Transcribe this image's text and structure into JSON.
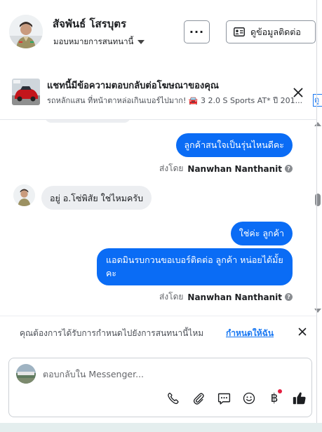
{
  "header": {
    "name": "สัจพันธ์ โสรบุตร",
    "assign_label": "มอบหมายการสนทนานี้",
    "more_label": "···",
    "contact_label": "ดูข้อมูลติดต่อ"
  },
  "ad_banner": {
    "title": "แชทนี้มีข้อความตอบกลับต่อโฆษณาของคุณ",
    "subtitle": "รถหลักแสน ที่หน้าตาหล่อเกินเบอร์ไปมาก! 🚘 3 2.0 S Sports AT* ปี 201...",
    "edge_text": "ดู"
  },
  "messages": [
    {
      "direction": "out",
      "text": "ลูกค้าสนใจเป็นรุ่นไหนดีคะ"
    },
    {
      "direction": "sent_by",
      "label": "ส่งโดย",
      "sender": "Nanwhan Nanthanit"
    },
    {
      "direction": "in",
      "text": "อยู่ อ.โซ่พิสัย ใช่ไหมครับ"
    },
    {
      "direction": "out",
      "text": "ใช่ค่ะ  ลูกค้า"
    },
    {
      "direction": "out",
      "text": "แอดมินรบกวนขอเบอร์ติดต่อ ลูกค้า  หน่อยได้มั้ยคะ"
    },
    {
      "direction": "sent_by",
      "label": "ส่งโดย",
      "sender": "Nanwhan Nanthanit"
    }
  ],
  "info_glyph": "?",
  "notice": {
    "text": "คุณต้องการได้รับการกำหนดไปยังการสนทนานี้ไหม",
    "link": "กำหนดให้ฉัน"
  },
  "composer": {
    "placeholder": "ตอบกลับใน Messenger...",
    "baht_symbol": "฿"
  },
  "colors": {
    "outgoing_bubble": "#0a6cf5",
    "incoming_bubble": "#eceef1",
    "link": "#1877f2",
    "badge_red": "#e41e3f"
  },
  "icons": [
    "id-card-icon",
    "close-icon",
    "info-icon",
    "phone-icon",
    "paperclip-icon",
    "saved-reply-icon",
    "emoji-icon",
    "baht-icon",
    "thumbs-up-icon"
  ]
}
